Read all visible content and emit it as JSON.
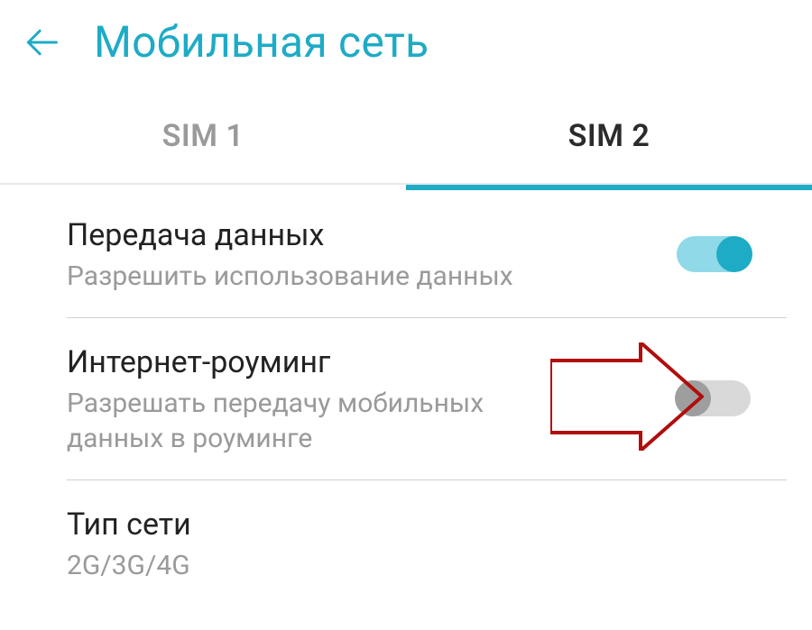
{
  "header": {
    "title": "Мобильная сеть"
  },
  "tabs": [
    {
      "label": "SIM 1",
      "active": false
    },
    {
      "label": "SIM 2",
      "active": true
    }
  ],
  "items": {
    "mobile_data": {
      "title": "Передача данных",
      "sub": "Разрешить использование данных",
      "on": true
    },
    "roaming": {
      "title": "Интернет-роуминг",
      "sub": "Разрешать передачу мобильных данных в роуминге",
      "on": false
    },
    "network_type": {
      "title": "Тип сети",
      "sub": "2G/3G/4G"
    }
  },
  "colors": {
    "accent": "#1eabc6",
    "arrow": "#b10d0d"
  }
}
